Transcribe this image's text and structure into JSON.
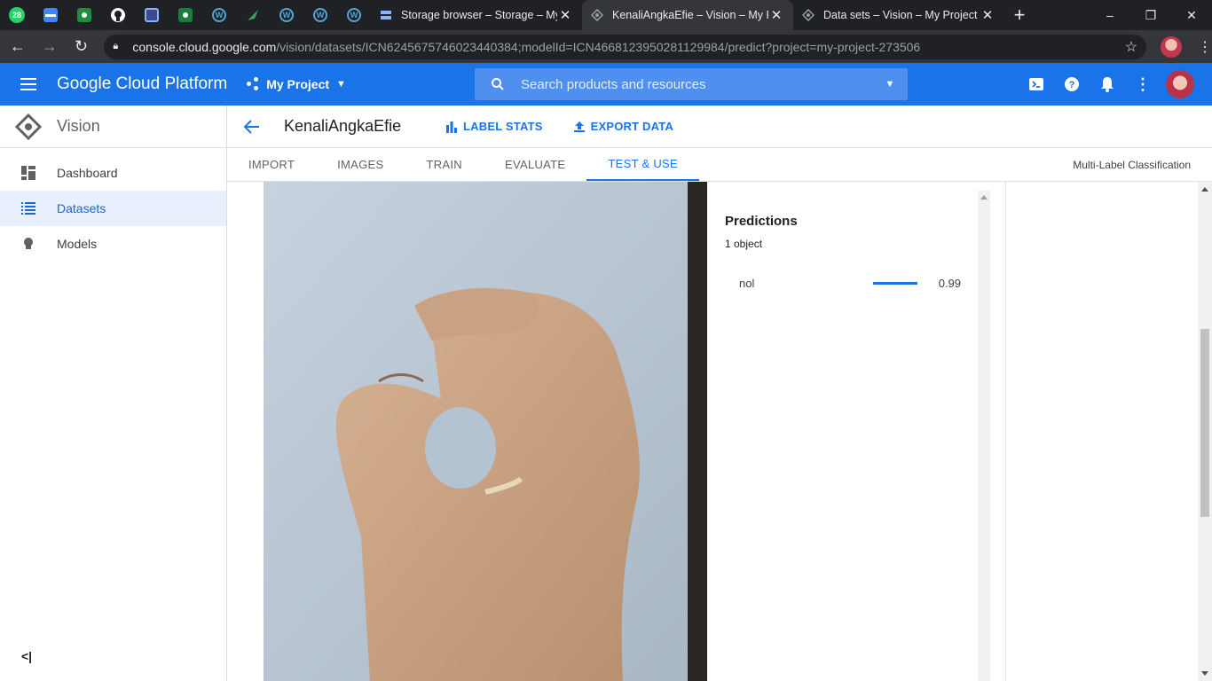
{
  "browser": {
    "pinned_tabs": [
      {
        "icon": "whatsapp-icon",
        "badge": "28",
        "color": "#25d366"
      },
      {
        "icon": "card-icon",
        "color": "#4285f4"
      },
      {
        "icon": "classroom-icon",
        "color": "#1e8e3e"
      },
      {
        "icon": "github-icon",
        "color": "#ffffff"
      },
      {
        "icon": "app-icon",
        "color": "#8ab4f8"
      },
      {
        "icon": "classroom-icon",
        "color": "#188038"
      },
      {
        "icon": "wordpress-icon",
        "color": "#4fa8d8"
      },
      {
        "icon": "feather-icon",
        "color": "#34a853"
      },
      {
        "icon": "wordpress-icon",
        "color": "#4fa8d8"
      },
      {
        "icon": "wordpress-icon",
        "color": "#4fa8d8"
      },
      {
        "icon": "wordpress-icon",
        "color": "#4fa8d8"
      }
    ],
    "tabs": [
      {
        "title": "Storage browser – Storage – My P",
        "active": false
      },
      {
        "title": "KenaliAngkaEfie – Vision – My Pr",
        "active": true
      },
      {
        "title": "Data sets – Vision – My Project –",
        "active": false
      }
    ],
    "new_tab": "+",
    "window_controls": {
      "minimize": "–",
      "restore": "❐",
      "close": "✕"
    },
    "url_host": "console.cloud.google.com",
    "url_path": "/vision/datasets/ICN6245675746023440384;modelId=ICN4668123950281129984/predict?project=my-project-273506"
  },
  "gcp": {
    "product": "Google Cloud Platform",
    "project": "My Project",
    "search_placeholder": "Search products and resources",
    "accent": "#1a73e8"
  },
  "sidebar": {
    "title": "Vision",
    "items": [
      {
        "label": "Dashboard",
        "icon": "dashboard-icon",
        "active": false
      },
      {
        "label": "Datasets",
        "icon": "list-icon",
        "active": true
      },
      {
        "label": "Models",
        "icon": "lightbulb-icon",
        "active": false
      }
    ],
    "collapse": "<|"
  },
  "dataset": {
    "title": "KenaliAngkaEfie",
    "actions": {
      "label_stats": "LABEL STATS",
      "export_data": "EXPORT DATA"
    },
    "tabs": [
      "IMPORT",
      "IMAGES",
      "TRAIN",
      "EVALUATE",
      "TEST & USE"
    ],
    "active_tab": "TEST & USE",
    "classification_type": "Multi-Label Classification"
  },
  "predictions": {
    "heading": "Predictions",
    "count_text": "1 object",
    "items": [
      {
        "label": "nol",
        "score": "0.99",
        "score_value": 0.99
      }
    ]
  }
}
